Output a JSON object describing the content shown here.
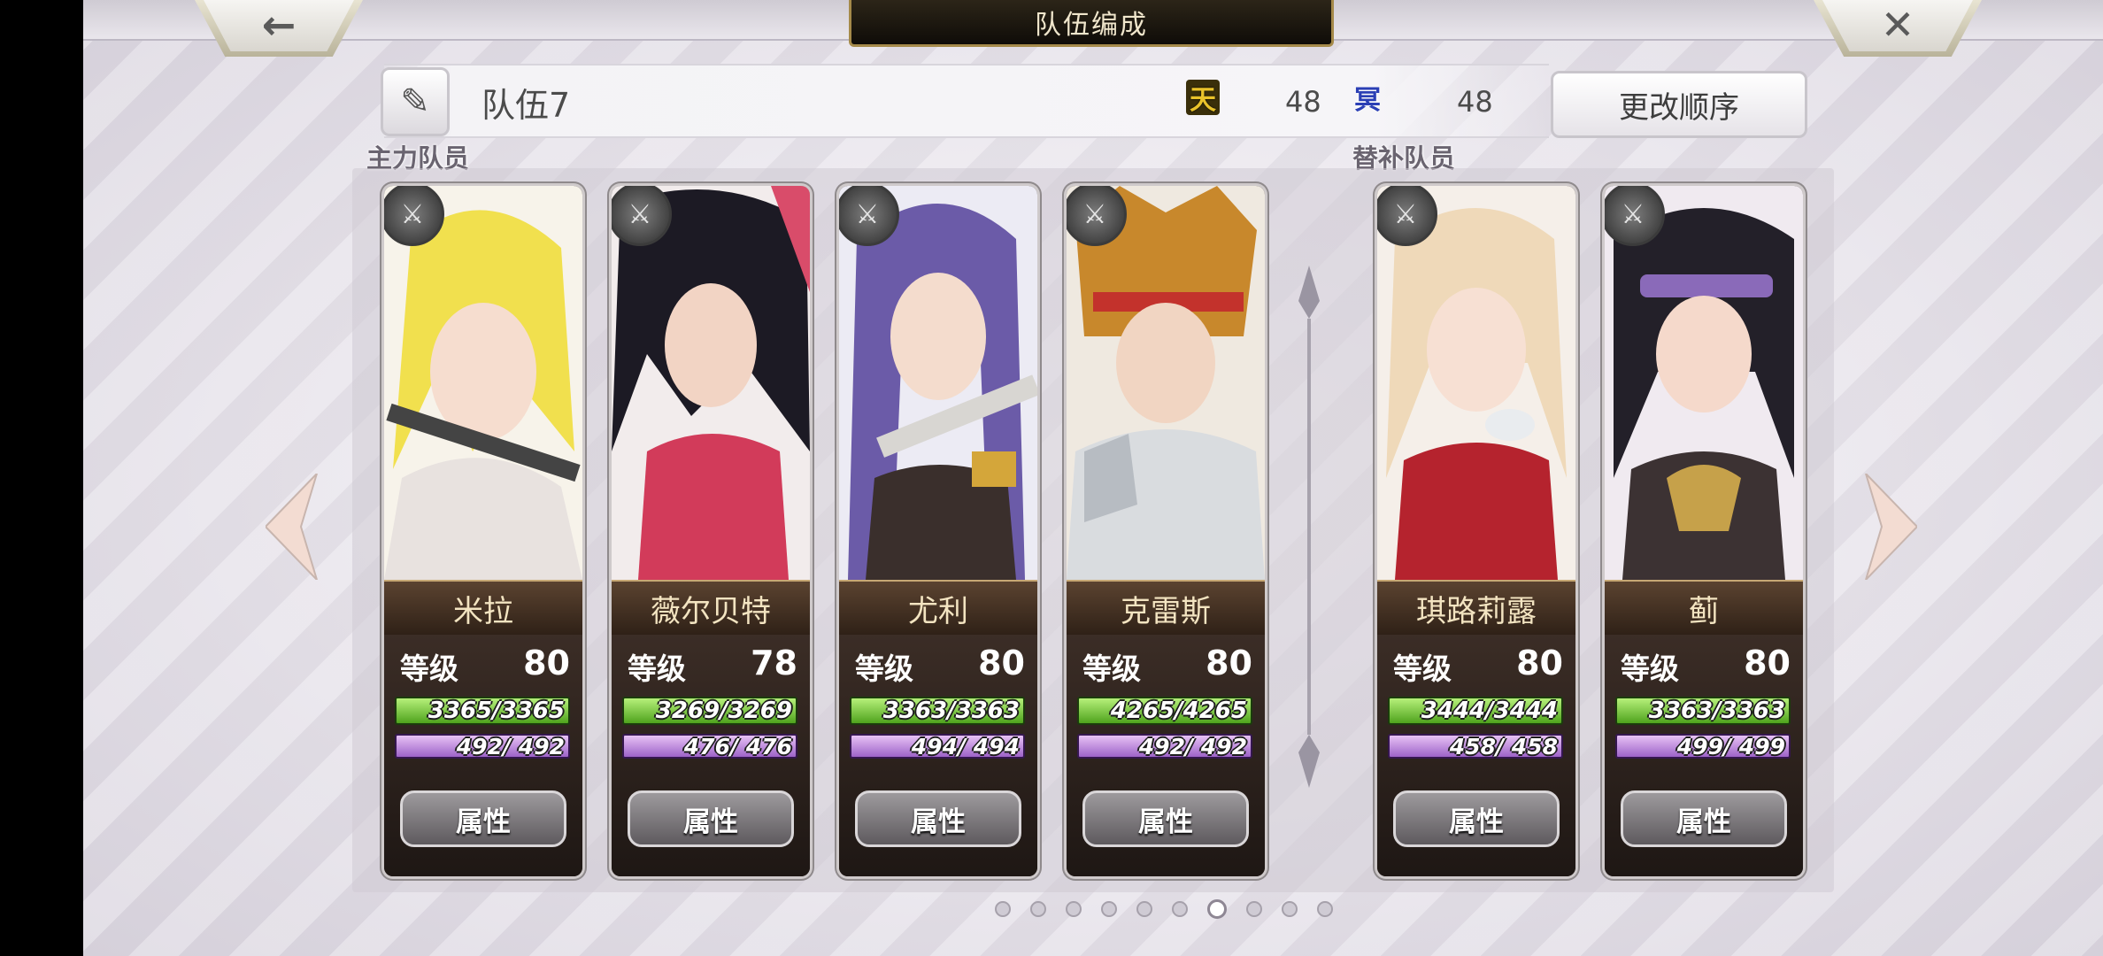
{
  "header": {
    "title": "队伍编成"
  },
  "party": {
    "name": "队伍7",
    "stat1_icon_text": "天",
    "stat1_value": "48",
    "stat2_icon_text": "冥",
    "stat2_value": "48",
    "order_button": "更改顺序"
  },
  "sections": {
    "main": "主力队员",
    "sub": "替补队员"
  },
  "labels": {
    "level": "等级",
    "attr": "属性"
  },
  "members": [
    {
      "name": "米拉",
      "level": "80",
      "hp": "3365/3365",
      "mp": "492/ 492"
    },
    {
      "name": "薇尔贝特",
      "level": "78",
      "hp": "3269/3269",
      "mp": "476/ 476"
    },
    {
      "name": "尤利",
      "level": "80",
      "hp": "3363/3363",
      "mp": "494/ 494"
    },
    {
      "name": "克雷斯",
      "level": "80",
      "hp": "4265/4265",
      "mp": "492/ 492"
    },
    {
      "name": "琪路莉露",
      "level": "80",
      "hp": "3444/3444",
      "mp": "458/ 458"
    },
    {
      "name": "蓟",
      "level": "80",
      "hp": "3363/3363",
      "mp": "499/ 499"
    }
  ],
  "pagination": {
    "total": 10,
    "current_index": 6
  },
  "colors": {
    "hp": "#4fa31d",
    "mp": "#9d63c8",
    "gold": "#c7a874"
  }
}
